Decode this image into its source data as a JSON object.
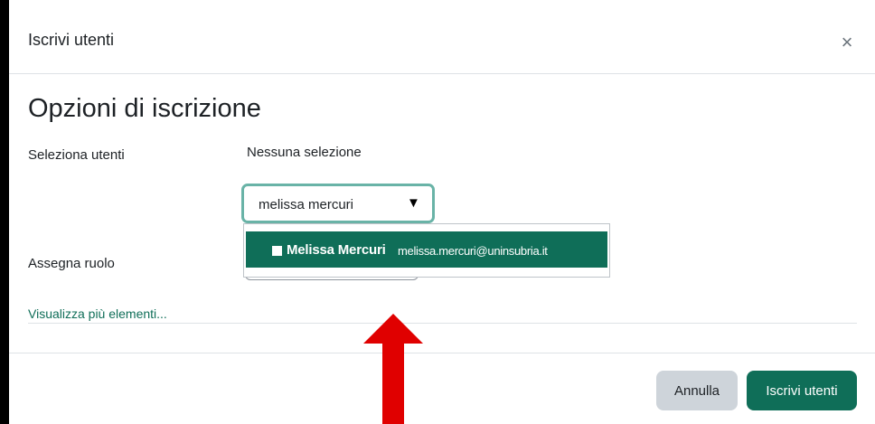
{
  "dialog": {
    "title": "Iscrivi utenti",
    "close_label": "×"
  },
  "enrolment": {
    "section_title": "Opzioni di iscrizione",
    "select_users_label": "Seleziona utenti",
    "no_selection_text": "Nessuna selezione",
    "search": {
      "value": "melissa mercuri",
      "caret": "▼"
    },
    "suggestions": [
      {
        "name": "Melissa Mercuri",
        "email": "melissa.mercuri@uninsubria.it"
      }
    ],
    "assign_role_label": "Assegna ruolo",
    "show_more_label": "Visualizza più elementi..."
  },
  "footer": {
    "cancel_label": "Annulla",
    "submit_label": "Iscrivi utenti"
  },
  "colors": {
    "accent": "#0f6e58",
    "focus_border": "#69b3a7",
    "annotation_arrow": "#e00000",
    "cancel_button": "#ced4da"
  },
  "icons": {
    "close": "close-icon",
    "dropdown": "caret-down-icon",
    "annotation": "up-arrow-icon"
  }
}
